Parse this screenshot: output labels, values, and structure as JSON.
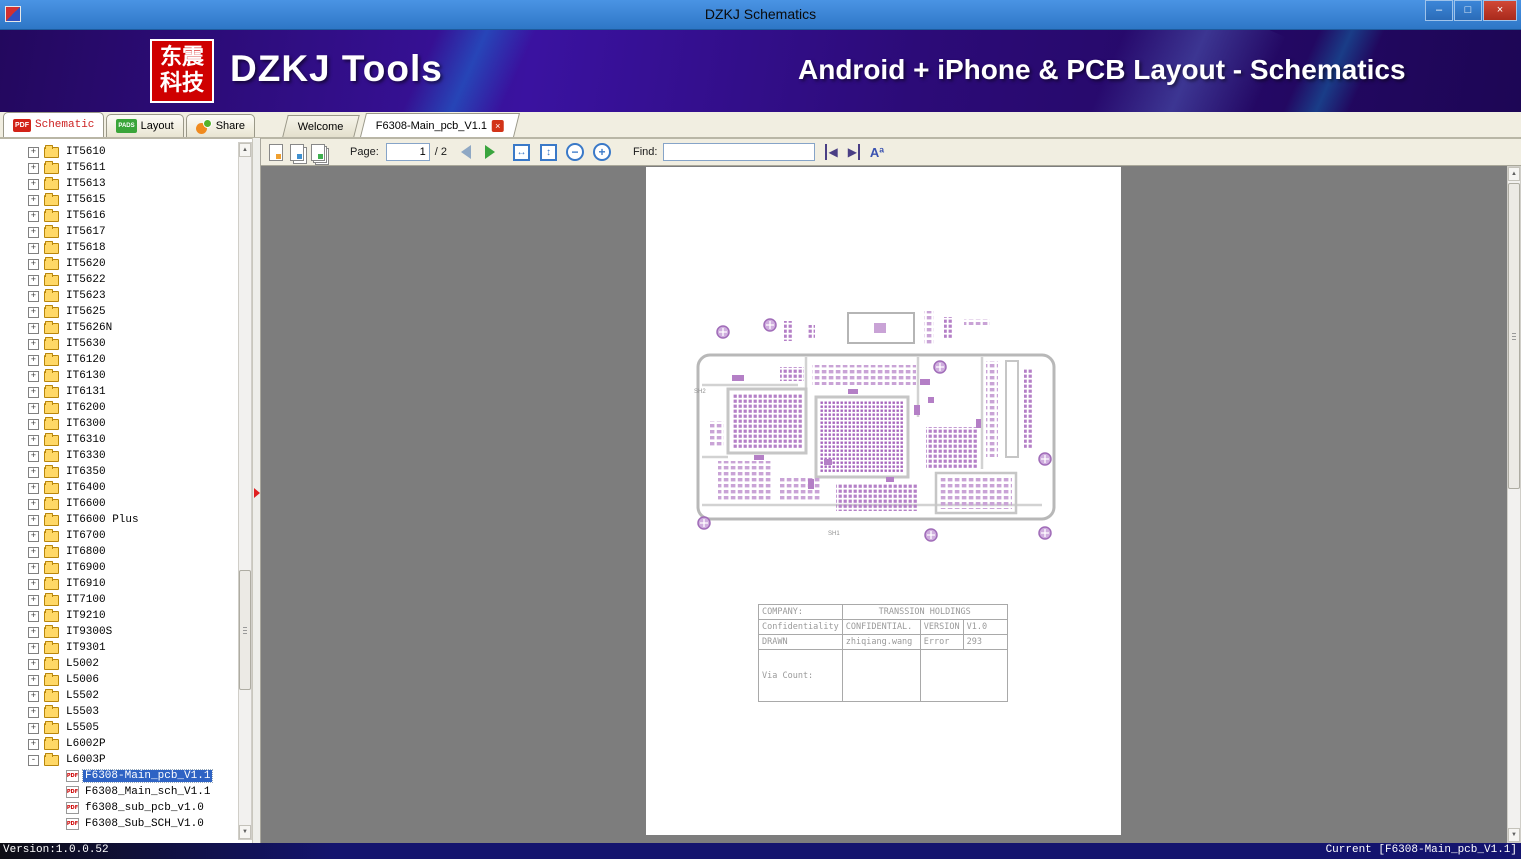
{
  "window": {
    "title": "DZKJ Schematics"
  },
  "icons": {
    "minimize": "–",
    "maximize": "□",
    "close": "×",
    "doc_close": "×",
    "plus": "+",
    "minus": "-",
    "pdf_badge": "PDF",
    "pads_badge": "PADS",
    "fit_width": "↔",
    "fit_page": "↕",
    "zoom_out": "−",
    "zoom_in": "+",
    "find_prev": "◀",
    "find_next": "▶",
    "match_case": "Aª",
    "scroll_up": "▲",
    "scroll_down": "▼"
  },
  "banner": {
    "logo_line1": "东震",
    "logo_line2": "科技",
    "brand": "DZKJ Tools",
    "subtitle": "Android + iPhone & PCB Layout - Schematics"
  },
  "tabs": {
    "schematic": "Schematic",
    "layout": "Layout",
    "share": "Share",
    "welcome": "Welcome",
    "document": "F6308-Main_pcb_V1.1"
  },
  "sidebar": {
    "folders": [
      "IT5610",
      "IT5611",
      "IT5613",
      "IT5615",
      "IT5616",
      "IT5617",
      "IT5618",
      "IT5620",
      "IT5622",
      "IT5623",
      "IT5625",
      "IT5626N",
      "IT5630",
      "IT6120",
      "IT6130",
      "IT6131",
      "IT6200",
      "IT6300",
      "IT6310",
      "IT6330",
      "IT6350",
      "IT6400",
      "IT6600",
      "IT6600 Plus",
      "IT6700",
      "IT6800",
      "IT6900",
      "IT6910",
      "IT7100",
      "IT9210",
      "IT9300S",
      "IT9301",
      "L5002",
      "L5006",
      "L5502",
      "L5503",
      "L5505",
      "L6002P"
    ],
    "expanded_folder": "L6003P",
    "files": [
      {
        "label": "F6308-Main_pcb_V1.1",
        "selected": true
      },
      {
        "label": "F6308_Main_sch_V1.1"
      },
      {
        "label": "f6308_sub_pcb_v1.0"
      },
      {
        "label": "F6308_Sub_SCH_V1.0"
      }
    ]
  },
  "toolbar": {
    "page_label": "Page:",
    "page_value": "1",
    "page_total": "/ 2",
    "find_label": "Find:",
    "find_value": ""
  },
  "document": {
    "pcb_labels": {
      "sh2": "SH2",
      "sh1": "SH1"
    },
    "table": {
      "company_label": "COMPANY:",
      "company_value": "TRANSSION HOLDINGS",
      "confidentiality_label": "Confidentiality",
      "confidentiality_value": "CONFIDENTIAL.",
      "version_label": "VERSION",
      "version_value": "V1.0",
      "drawn_label": "DRAWN",
      "drawn_value": "zhiqiang.wang",
      "error_label": "Error",
      "error_value": "293",
      "via_label": "Via Count:"
    }
  },
  "statusbar": {
    "version": "Version:1.0.0.52",
    "current": "Current [F6308-Main_pcb_V1.1]"
  }
}
